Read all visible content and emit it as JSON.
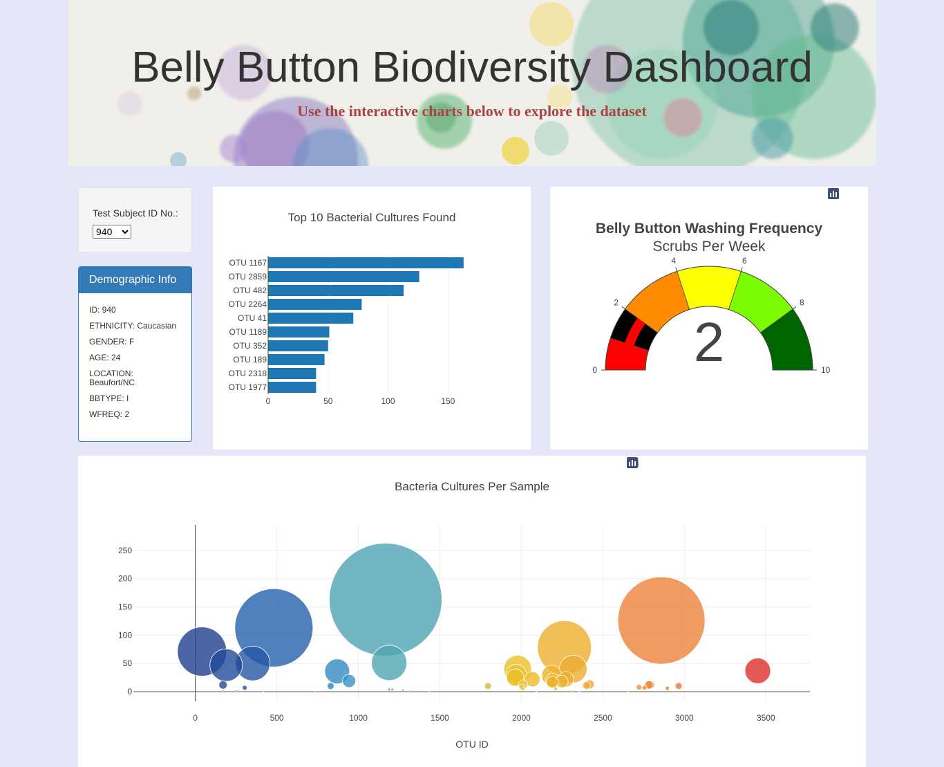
{
  "header": {
    "title": "Belly Button Biodiversity Dashboard",
    "subtitle": "Use the interactive charts below to explore the dataset"
  },
  "selector": {
    "label": "Test Subject ID No.:",
    "selected": "940"
  },
  "demographics": {
    "heading": "Demographic Info",
    "rows": [
      "ID: 940",
      "ETHNICITY: Caucasian",
      "GENDER: F",
      "AGE: 24",
      "LOCATION: Beaufort/NC",
      "BBTYPE: I",
      "WFREQ: 2"
    ]
  },
  "colors": {
    "page_bg": "#e6e6fa",
    "bar": "#1f77b4",
    "panel_primary": "#337ab7",
    "subtitle": "#a94442"
  },
  "icons": {
    "gauge_modebar": [
      "camera-icon",
      "plotly-logo-icon"
    ],
    "bubble_modebar": [
      "camera-icon",
      "zoom-icon",
      "pan-icon",
      "box-select-icon",
      "lasso-select-icon",
      "zoom-in-icon",
      "zoom-out-icon",
      "autoscale-icon",
      "reset-axes-icon",
      "spike-lines-icon",
      "hover-closest-icon",
      "hover-compare-icon",
      "plotly-logo-icon"
    ]
  },
  "chart_data": [
    {
      "type": "bar",
      "orientation": "horizontal",
      "title": "Top 10 Bacterial Cultures Found",
      "categories": [
        "OTU 1167",
        "OTU 2859",
        "OTU 482",
        "OTU 2264",
        "OTU 41",
        "OTU 1189",
        "OTU 352",
        "OTU 189",
        "OTU 2318",
        "OTU 1977"
      ],
      "values": [
        163,
        126,
        113,
        78,
        71,
        51,
        50,
        47,
        40,
        40
      ],
      "xticks": [
        0,
        50,
        100,
        150
      ],
      "xlim": [
        0,
        170
      ],
      "grid": true,
      "color": "#1f77b4"
    },
    {
      "type": "gauge",
      "title": "Belly Button Washing Frequency",
      "subtitle": "Scrubs Per Week",
      "value": 2,
      "range": [
        0,
        10
      ],
      "ticks": [
        0,
        2,
        4,
        6,
        8,
        10
      ],
      "steps": [
        {
          "range": [
            0,
            1
          ],
          "color": "#ff0000"
        },
        {
          "range": [
            1,
            2
          ],
          "color": "#000000"
        },
        {
          "range": [
            2,
            4
          ],
          "color": "#ff8c00"
        },
        {
          "range": [
            4,
            6
          ],
          "color": "#ffff00"
        },
        {
          "range": [
            6,
            8
          ],
          "color": "#7cfc00"
        },
        {
          "range": [
            8,
            10
          ],
          "color": "#006400"
        }
      ],
      "bar_color": "#ff0000"
    },
    {
      "type": "scatter",
      "style": "bubble",
      "title": "Bacteria Cultures Per Sample",
      "xlabel": "OTU ID",
      "ylabel": "",
      "xticks": [
        0,
        500,
        1000,
        1500,
        2000,
        2500,
        3000,
        3500
      ],
      "yticks": [
        0,
        50,
        100,
        150,
        200,
        250
      ],
      "xlim": [
        -380,
        3770
      ],
      "ylim": [
        -17,
        295
      ],
      "grid": true,
      "colorscale": "Earth",
      "points": [
        {
          "x": 1167,
          "y": 163
        },
        {
          "x": 2859,
          "y": 126
        },
        {
          "x": 482,
          "y": 113
        },
        {
          "x": 2264,
          "y": 78
        },
        {
          "x": 41,
          "y": 71
        },
        {
          "x": 1189,
          "y": 51
        },
        {
          "x": 352,
          "y": 50
        },
        {
          "x": 189,
          "y": 47
        },
        {
          "x": 2318,
          "y": 40
        },
        {
          "x": 1977,
          "y": 40
        },
        {
          "x": 3450,
          "y": 37
        },
        {
          "x": 870,
          "y": 36
        },
        {
          "x": 1968,
          "y": 30
        },
        {
          "x": 1962,
          "y": 25
        },
        {
          "x": 2186,
          "y": 29
        },
        {
          "x": 2068,
          "y": 22
        },
        {
          "x": 2274,
          "y": 22
        },
        {
          "x": 2191,
          "y": 20
        },
        {
          "x": 943,
          "y": 19
        },
        {
          "x": 2248,
          "y": 18
        },
        {
          "x": 2190,
          "y": 17
        },
        {
          "x": 2011,
          "y": 13
        },
        {
          "x": 2419,
          "y": 13
        },
        {
          "x": 2399,
          "y": 11
        },
        {
          "x": 170,
          "y": 12
        },
        {
          "x": 2791,
          "y": 12
        },
        {
          "x": 2782,
          "y": 12
        },
        {
          "x": 1795,
          "y": 10
        },
        {
          "x": 2965,
          "y": 10
        },
        {
          "x": 830,
          "y": 10
        },
        {
          "x": 2722,
          "y": 8
        },
        {
          "x": 2002,
          "y": 8
        },
        {
          "x": 2755,
          "y": 7
        },
        {
          "x": 303,
          "y": 7
        },
        {
          "x": 2895,
          "y": 6
        },
        {
          "x": 2011,
          "y": 5
        },
        {
          "x": 2211,
          "y": 5
        },
        {
          "x": 1189,
          "y": 4
        },
        {
          "x": 1208,
          "y": 4
        },
        {
          "x": 1273,
          "y": 3
        },
        {
          "x": 1314,
          "y": 2
        },
        {
          "x": 2315,
          "y": 2
        },
        {
          "x": 171,
          "y": 2
        },
        {
          "x": 254,
          "y": 2
        },
        {
          "x": 415,
          "y": 1
        },
        {
          "x": 736,
          "y": 1
        },
        {
          "x": 1435,
          "y": 1
        },
        {
          "x": 2093,
          "y": 1
        },
        {
          "x": 2355,
          "y": 1
        },
        {
          "x": 2654,
          "y": 1
        }
      ]
    }
  ]
}
